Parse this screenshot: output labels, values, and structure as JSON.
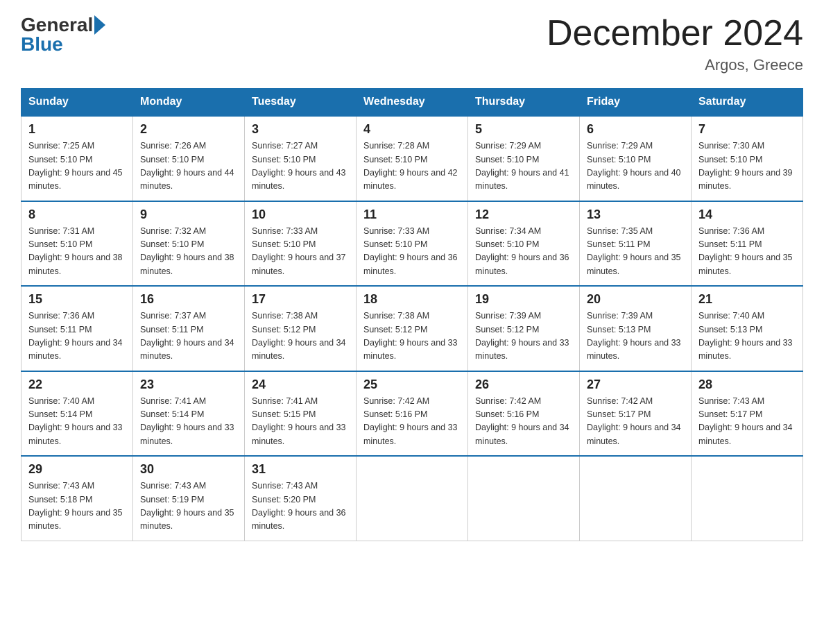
{
  "header": {
    "logo_general": "General",
    "logo_blue": "Blue",
    "month_title": "December 2024",
    "location": "Argos, Greece"
  },
  "weekdays": [
    "Sunday",
    "Monday",
    "Tuesday",
    "Wednesday",
    "Thursday",
    "Friday",
    "Saturday"
  ],
  "weeks": [
    [
      {
        "day": "1",
        "sunrise": "7:25 AM",
        "sunset": "5:10 PM",
        "daylight": "9 hours and 45 minutes."
      },
      {
        "day": "2",
        "sunrise": "7:26 AM",
        "sunset": "5:10 PM",
        "daylight": "9 hours and 44 minutes."
      },
      {
        "day": "3",
        "sunrise": "7:27 AM",
        "sunset": "5:10 PM",
        "daylight": "9 hours and 43 minutes."
      },
      {
        "day": "4",
        "sunrise": "7:28 AM",
        "sunset": "5:10 PM",
        "daylight": "9 hours and 42 minutes."
      },
      {
        "day": "5",
        "sunrise": "7:29 AM",
        "sunset": "5:10 PM",
        "daylight": "9 hours and 41 minutes."
      },
      {
        "day": "6",
        "sunrise": "7:29 AM",
        "sunset": "5:10 PM",
        "daylight": "9 hours and 40 minutes."
      },
      {
        "day": "7",
        "sunrise": "7:30 AM",
        "sunset": "5:10 PM",
        "daylight": "9 hours and 39 minutes."
      }
    ],
    [
      {
        "day": "8",
        "sunrise": "7:31 AM",
        "sunset": "5:10 PM",
        "daylight": "9 hours and 38 minutes."
      },
      {
        "day": "9",
        "sunrise": "7:32 AM",
        "sunset": "5:10 PM",
        "daylight": "9 hours and 38 minutes."
      },
      {
        "day": "10",
        "sunrise": "7:33 AM",
        "sunset": "5:10 PM",
        "daylight": "9 hours and 37 minutes."
      },
      {
        "day": "11",
        "sunrise": "7:33 AM",
        "sunset": "5:10 PM",
        "daylight": "9 hours and 36 minutes."
      },
      {
        "day": "12",
        "sunrise": "7:34 AM",
        "sunset": "5:10 PM",
        "daylight": "9 hours and 36 minutes."
      },
      {
        "day": "13",
        "sunrise": "7:35 AM",
        "sunset": "5:11 PM",
        "daylight": "9 hours and 35 minutes."
      },
      {
        "day": "14",
        "sunrise": "7:36 AM",
        "sunset": "5:11 PM",
        "daylight": "9 hours and 35 minutes."
      }
    ],
    [
      {
        "day": "15",
        "sunrise": "7:36 AM",
        "sunset": "5:11 PM",
        "daylight": "9 hours and 34 minutes."
      },
      {
        "day": "16",
        "sunrise": "7:37 AM",
        "sunset": "5:11 PM",
        "daylight": "9 hours and 34 minutes."
      },
      {
        "day": "17",
        "sunrise": "7:38 AM",
        "sunset": "5:12 PM",
        "daylight": "9 hours and 34 minutes."
      },
      {
        "day": "18",
        "sunrise": "7:38 AM",
        "sunset": "5:12 PM",
        "daylight": "9 hours and 33 minutes."
      },
      {
        "day": "19",
        "sunrise": "7:39 AM",
        "sunset": "5:12 PM",
        "daylight": "9 hours and 33 minutes."
      },
      {
        "day": "20",
        "sunrise": "7:39 AM",
        "sunset": "5:13 PM",
        "daylight": "9 hours and 33 minutes."
      },
      {
        "day": "21",
        "sunrise": "7:40 AM",
        "sunset": "5:13 PM",
        "daylight": "9 hours and 33 minutes."
      }
    ],
    [
      {
        "day": "22",
        "sunrise": "7:40 AM",
        "sunset": "5:14 PM",
        "daylight": "9 hours and 33 minutes."
      },
      {
        "day": "23",
        "sunrise": "7:41 AM",
        "sunset": "5:14 PM",
        "daylight": "9 hours and 33 minutes."
      },
      {
        "day": "24",
        "sunrise": "7:41 AM",
        "sunset": "5:15 PM",
        "daylight": "9 hours and 33 minutes."
      },
      {
        "day": "25",
        "sunrise": "7:42 AM",
        "sunset": "5:16 PM",
        "daylight": "9 hours and 33 minutes."
      },
      {
        "day": "26",
        "sunrise": "7:42 AM",
        "sunset": "5:16 PM",
        "daylight": "9 hours and 34 minutes."
      },
      {
        "day": "27",
        "sunrise": "7:42 AM",
        "sunset": "5:17 PM",
        "daylight": "9 hours and 34 minutes."
      },
      {
        "day": "28",
        "sunrise": "7:43 AM",
        "sunset": "5:17 PM",
        "daylight": "9 hours and 34 minutes."
      }
    ],
    [
      {
        "day": "29",
        "sunrise": "7:43 AM",
        "sunset": "5:18 PM",
        "daylight": "9 hours and 35 minutes."
      },
      {
        "day": "30",
        "sunrise": "7:43 AM",
        "sunset": "5:19 PM",
        "daylight": "9 hours and 35 minutes."
      },
      {
        "day": "31",
        "sunrise": "7:43 AM",
        "sunset": "5:20 PM",
        "daylight": "9 hours and 36 minutes."
      },
      null,
      null,
      null,
      null
    ]
  ]
}
